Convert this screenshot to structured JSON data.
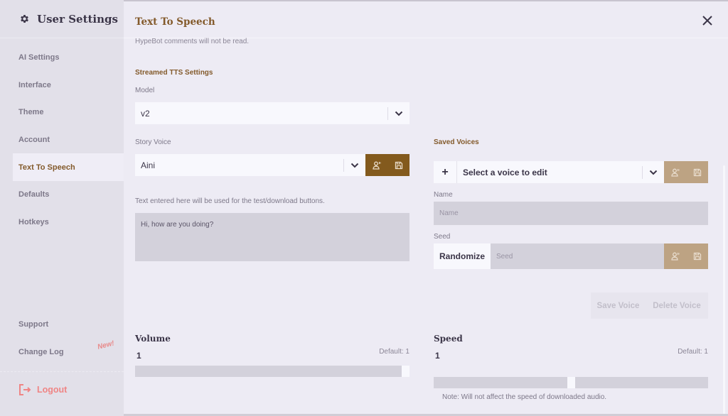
{
  "sidebar": {
    "title": "User Settings",
    "items": [
      {
        "label": "AI Settings"
      },
      {
        "label": "Interface"
      },
      {
        "label": "Theme"
      },
      {
        "label": "Account"
      },
      {
        "label": "Text To Speech",
        "active": true
      },
      {
        "label": "Defaults"
      },
      {
        "label": "Hotkeys"
      }
    ],
    "bottom_items": [
      {
        "label": "Support"
      },
      {
        "label": "Change Log",
        "badge": "New!"
      }
    ],
    "logout_label": "Logout"
  },
  "main": {
    "title": "Text To Speech",
    "hypebot_note": "HypeBot comments will not be read.",
    "streamed_section_title": "Streamed TTS Settings",
    "model": {
      "label": "Model",
      "value": "v2"
    },
    "story_voice": {
      "label": "Story Voice",
      "value": "Aini"
    },
    "test_text": {
      "hint": "Text entered here will be used for the test/download buttons.",
      "value": "Hi, how are you doing?"
    },
    "saved_voices": {
      "title": "Saved Voices",
      "select_placeholder": "Select a voice to edit",
      "add_label": "+",
      "name_label": "Name",
      "name_placeholder": "Name",
      "seed_label": "Seed",
      "seed_placeholder": "Seed",
      "randomize_label": "Randomize",
      "save_voice_label": "Save Voice",
      "delete_voice_label": "Delete Voice"
    },
    "volume": {
      "title": "Volume",
      "value": "1",
      "default_label": "Default: 1",
      "fraction": 1.0
    },
    "speed": {
      "title": "Speed",
      "value": "1",
      "default_label": "Default: 1",
      "fraction": 0.5,
      "note": "Note: Will not affect the speed of downloaded audio."
    }
  },
  "colors": {
    "accent": "#835a2b",
    "button_active": "#835a1d",
    "button_disabled": "#bda383",
    "logout": "#ef8585"
  }
}
